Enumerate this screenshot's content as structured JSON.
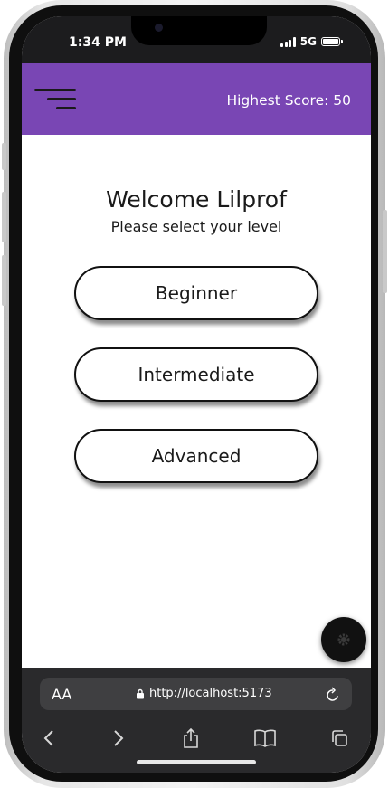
{
  "status_bar": {
    "time": "1:34 PM",
    "network": "5G"
  },
  "header": {
    "menu_icon": "hamburger-menu-icon",
    "highest_score": "Highest Score: 50",
    "background_color": "#7946b4"
  },
  "main": {
    "title": "Welcome Lilprof",
    "subtitle": "Please select your level",
    "levels": [
      {
        "label": "Beginner"
      },
      {
        "label": "Intermediate"
      },
      {
        "label": "Advanced"
      }
    ],
    "fab_icon": "settings-gear-icon"
  },
  "browser": {
    "text_size_label": "AA",
    "url": "http://localhost:5173",
    "lock_icon": "lock-icon",
    "reload_icon": "reload-icon",
    "toolbar_icons": [
      "back-icon",
      "forward-icon",
      "share-icon",
      "bookmarks-icon",
      "tabs-icon"
    ]
  }
}
